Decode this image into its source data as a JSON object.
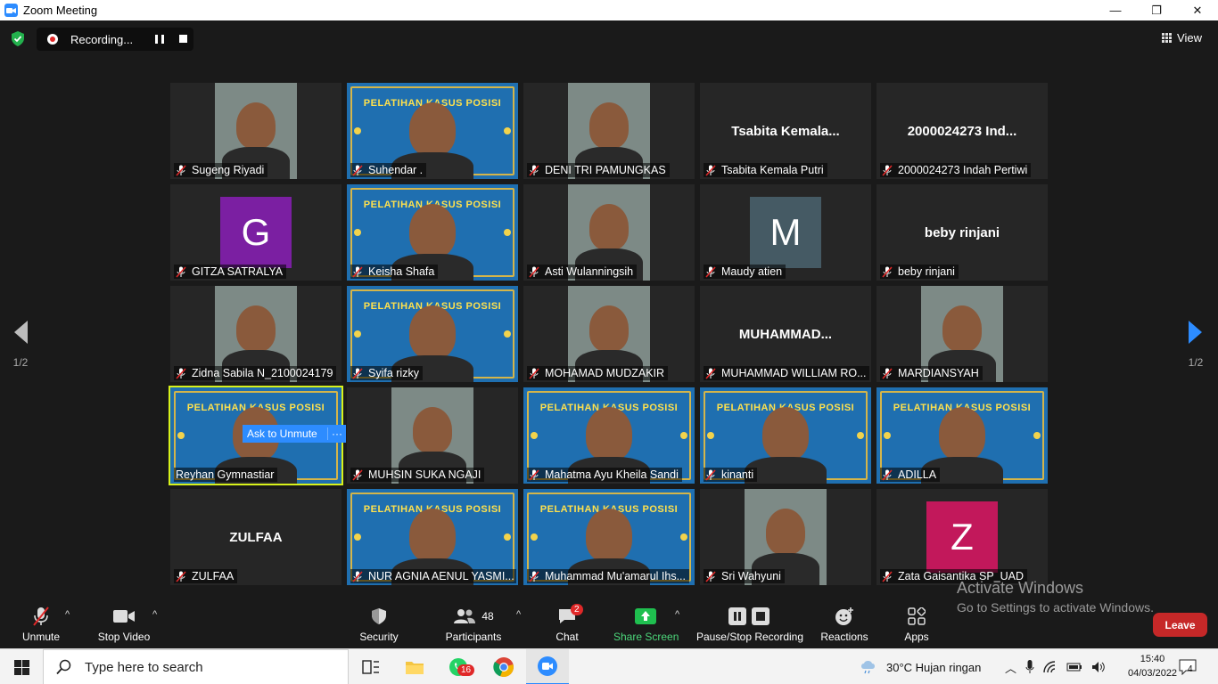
{
  "window": {
    "title": "Zoom Meeting",
    "controls": [
      "—",
      "❐",
      "✕"
    ]
  },
  "recording": {
    "label": "Recording..."
  },
  "view": {
    "label": "View"
  },
  "pagination": {
    "left": "1/2",
    "right": "1/2"
  },
  "tiles": [
    {
      "name": "Sugeng Riyadi",
      "type": "video"
    },
    {
      "name": "Suhendar .",
      "type": "banner"
    },
    {
      "name": "DENI TRI PAMUNGKAS",
      "type": "video"
    },
    {
      "name": "Tsabita Kemala Putri",
      "type": "text",
      "display": "Tsabita  Kemala..."
    },
    {
      "name": "2000024273 Indah Pertiwi",
      "type": "text",
      "display": "2000024273 Ind..."
    },
    {
      "name": "GITZA SATRALYA",
      "type": "avatar",
      "letter": "G",
      "color": "#7b1fa2"
    },
    {
      "name": "Keisha Shafa",
      "type": "banner"
    },
    {
      "name": "Asti Wulanningsih",
      "type": "video"
    },
    {
      "name": "Maudy atien",
      "type": "avatar",
      "letter": "M",
      "color": "#455a64"
    },
    {
      "name": "beby rinjani",
      "type": "text",
      "display": "beby rinjani"
    },
    {
      "name": "Zidna Sabila N_2100024179",
      "type": "video"
    },
    {
      "name": "Syifa rizky",
      "type": "banner"
    },
    {
      "name": "MOHAMAD MUDZAKIR",
      "type": "video"
    },
    {
      "name": "MUHAMMAD WILLIAM RO...",
      "type": "text",
      "display": "MUHAMMAD..."
    },
    {
      "name": "MARDIANSYAH",
      "type": "video"
    },
    {
      "name": "Reyhan Gymnastiar",
      "type": "banner",
      "active": true
    },
    {
      "name": "MUHSIN SUKA NGAJI",
      "type": "video"
    },
    {
      "name": "Mahatma Ayu Kheila Sandi",
      "type": "banner"
    },
    {
      "name": "kinanti",
      "type": "banner"
    },
    {
      "name": "ADILLA",
      "type": "banner"
    },
    {
      "name": "ZULFAA",
      "type": "text",
      "display": "ZULFAA"
    },
    {
      "name": "NUR AGNIA AENUL YASMI...",
      "type": "banner"
    },
    {
      "name": "Muhammad Mu'amarul Ihs...",
      "type": "banner"
    },
    {
      "name": "Sri Wahyuni",
      "type": "video"
    },
    {
      "name": "Zata Gaisantika SP_UAD",
      "type": "avatar",
      "letter": "Z",
      "color": "#c2185b"
    }
  ],
  "banner_text": "PELATIHAN KASUS POSISI",
  "ask_unmute": {
    "label": "Ask to Unmute",
    "more": "···"
  },
  "watermark": {
    "line1": "Activate Windows",
    "line2": "Go to Settings to activate Windows."
  },
  "toolbar": {
    "unmute": "Unmute",
    "stop_video": "Stop Video",
    "security": "Security",
    "participants": "Participants",
    "participants_count": "48",
    "chat": "Chat",
    "chat_badge": "2",
    "share_screen": "Share Screen",
    "pause_recording": "Pause/Stop Recording",
    "reactions": "Reactions",
    "apps": "Apps",
    "leave": "Leave"
  },
  "taskbar": {
    "search_placeholder": "Type here to search",
    "whatsapp_badge": "16",
    "weather": "30°C  Hujan ringan",
    "time": "15:40",
    "date": "04/03/2022",
    "notifications": "4"
  },
  "colors": {
    "accent": "#2d8cff",
    "leave": "#c62828",
    "share": "#1fbf4f",
    "active_border": "#d8f21b"
  }
}
